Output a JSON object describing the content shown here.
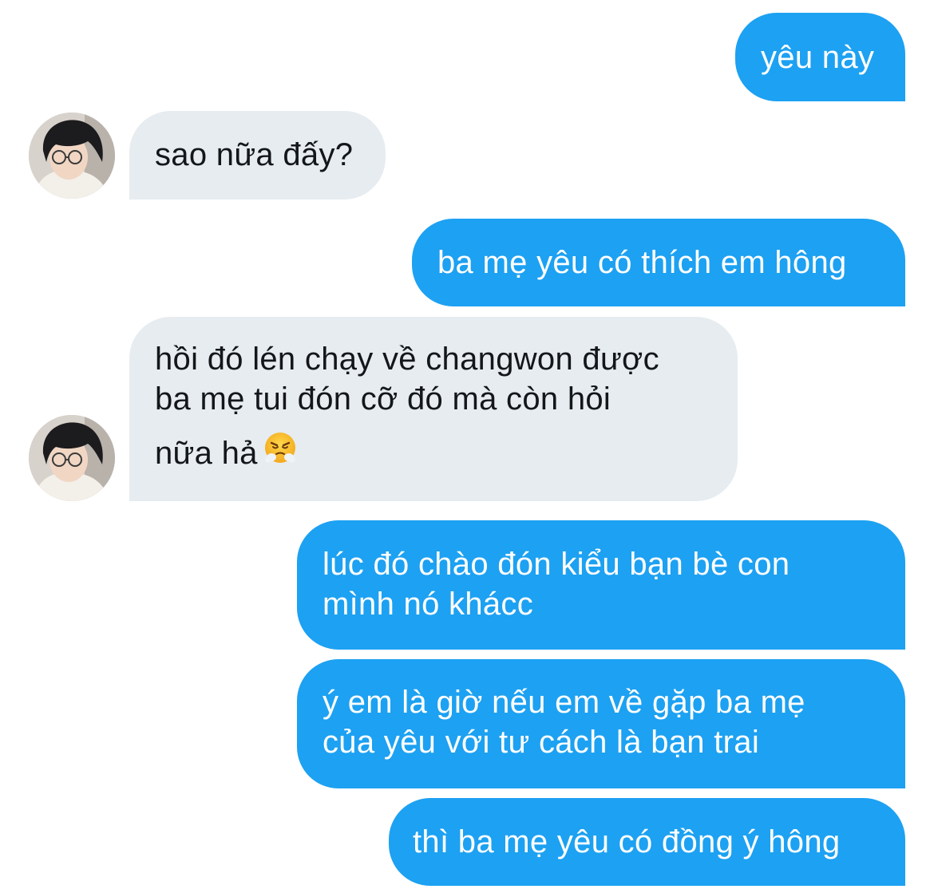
{
  "conversation": {
    "messages": [
      {
        "sender": "me",
        "lines": [
          "yêu này"
        ]
      },
      {
        "sender": "them",
        "lines": [
          "sao nữa đấy?"
        ]
      },
      {
        "sender": "me",
        "lines": [
          "ba mẹ yêu có thích em hông"
        ]
      },
      {
        "sender": "them",
        "lines": [
          "hồi đó lén chạy về changwon được",
          "ba mẹ tui đón cỡ đó mà còn hỏi",
          "nữa hả"
        ],
        "emoji": "face-with-steam-from-nose"
      },
      {
        "sender": "me",
        "lines": [
          "lúc đó chào đón kiểu bạn bè con",
          "mình nó khácc"
        ]
      },
      {
        "sender": "me",
        "lines": [
          "ý em là giờ nếu em về gặp ba mẹ",
          "của yêu với tư cách là bạn trai"
        ]
      },
      {
        "sender": "me",
        "lines": [
          "thì ba mẹ yêu có đồng ý hông"
        ]
      }
    ]
  },
  "colors": {
    "sent_bubble": "#1da1f2",
    "received_bubble": "#e6ecf0",
    "sent_text": "#ffffff",
    "received_text": "#14171a"
  },
  "icons": {
    "avatar": "contact-avatar",
    "emoji": "face-with-steam-from-nose"
  }
}
